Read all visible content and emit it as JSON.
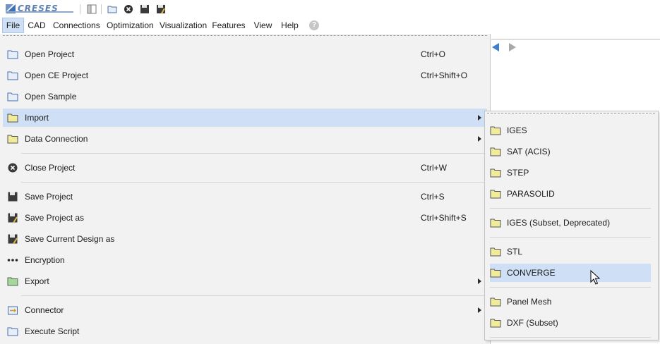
{
  "app": {
    "logo_text": "CRESES"
  },
  "menubar": {
    "items": [
      "File",
      "CAD",
      "Connections",
      "Optimization",
      "Visualization",
      "Features",
      "View",
      "Help"
    ],
    "active": "File",
    "help_icon": "help-circle-icon"
  },
  "file_menu": {
    "items": [
      {
        "label": "Open Project",
        "shortcut": "Ctrl+O",
        "icon": "folder-open-icon"
      },
      {
        "label": "Open CE Project",
        "shortcut": "Ctrl+Shift+O",
        "icon": "folder-open-icon"
      },
      {
        "label": "Open Sample",
        "shortcut": "",
        "icon": "folder-open-icon"
      },
      {
        "label": "Import",
        "shortcut": "",
        "icon": "folder-icon",
        "submenu": true,
        "highlighted": true
      },
      {
        "label": "Data Connection",
        "shortcut": "",
        "icon": "folder-icon",
        "submenu": true
      },
      {
        "label": "Close Project",
        "shortcut": "Ctrl+W",
        "icon": "close-circle-icon"
      },
      {
        "label": "Save Project",
        "shortcut": "Ctrl+S",
        "icon": "save-icon"
      },
      {
        "label": "Save Project as",
        "shortcut": "Ctrl+Shift+S",
        "icon": "save-as-icon"
      },
      {
        "label": "Save Current Design as",
        "shortcut": "",
        "icon": "save-as-icon"
      },
      {
        "label": "Encryption",
        "shortcut": "",
        "icon": "more-dots-icon"
      },
      {
        "label": "Export",
        "shortcut": "",
        "icon": "folder-export-icon",
        "submenu": true
      },
      {
        "label": "Connector",
        "shortcut": "",
        "icon": "connector-icon",
        "submenu": true
      },
      {
        "label": "Execute Script",
        "shortcut": "",
        "icon": "folder-open-icon"
      }
    ]
  },
  "import_submenu": {
    "items": [
      {
        "label": "IGES"
      },
      {
        "label": "SAT (ACIS)"
      },
      {
        "label": "STEP"
      },
      {
        "label": "PARASOLID"
      },
      {
        "label": "IGES (Subset, Deprecated)"
      },
      {
        "label": "STL"
      },
      {
        "label": "CONVERGE",
        "highlighted": true
      },
      {
        "label": "Panel Mesh"
      },
      {
        "label": "DXF (Subset)"
      }
    ]
  },
  "colors": {
    "highlight": "#cfe0f6",
    "menu_bg": "#f2f2f2",
    "folder_fill": "#f0ec9c",
    "accent": "#3d7fd1"
  }
}
